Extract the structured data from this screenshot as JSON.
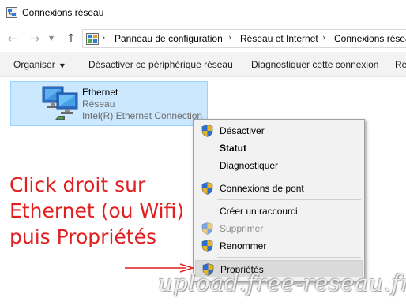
{
  "window": {
    "title": "Connexions réseau",
    "icon": "network-connections-icon"
  },
  "navigation": {
    "back_icon": "back-arrow-icon",
    "forward_icon": "forward-arrow-icon",
    "recent_icon": "chevron-down-icon",
    "up_icon": "up-arrow-icon",
    "breadcrumb": [
      "Panneau de configuration",
      "Réseau et Internet",
      "Connexions réseau"
    ]
  },
  "toolbar": {
    "organize_label": "Organiser",
    "disable_label": "Désactiver ce périphérique réseau",
    "diagnose_label": "Diagnostiquer cette connexion",
    "rename_label": "Re"
  },
  "adapter": {
    "name": "Ethernet",
    "network": "Réseau",
    "device": "Intel(R) Ethernet Connection",
    "icon": "ethernet-adapter-icon",
    "selected": true
  },
  "context_menu": {
    "items": [
      {
        "label": "Désactiver",
        "icon": "uac-shield-icon",
        "bold": false,
        "enabled": true
      },
      {
        "label": "Statut",
        "icon": "",
        "bold": true,
        "enabled": true
      },
      {
        "label": "Diagnostiquer",
        "icon": "",
        "bold": false,
        "enabled": true
      },
      {
        "label": "Connexions de pont",
        "icon": "uac-shield-icon",
        "bold": false,
        "enabled": true
      },
      {
        "label": "Créer un raccourci",
        "icon": "",
        "bold": false,
        "enabled": true
      },
      {
        "label": "Supprimer",
        "icon": "uac-shield-icon",
        "bold": false,
        "enabled": false
      },
      {
        "label": "Renommer",
        "icon": "uac-shield-icon",
        "bold": false,
        "enabled": true
      },
      {
        "label": "Propriétés",
        "icon": "uac-shield-icon",
        "bold": false,
        "enabled": true,
        "highlighted": true
      }
    ]
  },
  "annotation": {
    "lines": [
      "Click droit sur",
      "Ethernet (ou Wifi)",
      "puis Propriétés"
    ],
    "color": "#e11f1f"
  },
  "watermark": "upload.free-reseau.fr",
  "colors": {
    "selection_fill": "#cce8ff",
    "selection_border": "#99d1ff",
    "menu_background": "#f2f2f2",
    "menu_highlight": "#dadada"
  }
}
